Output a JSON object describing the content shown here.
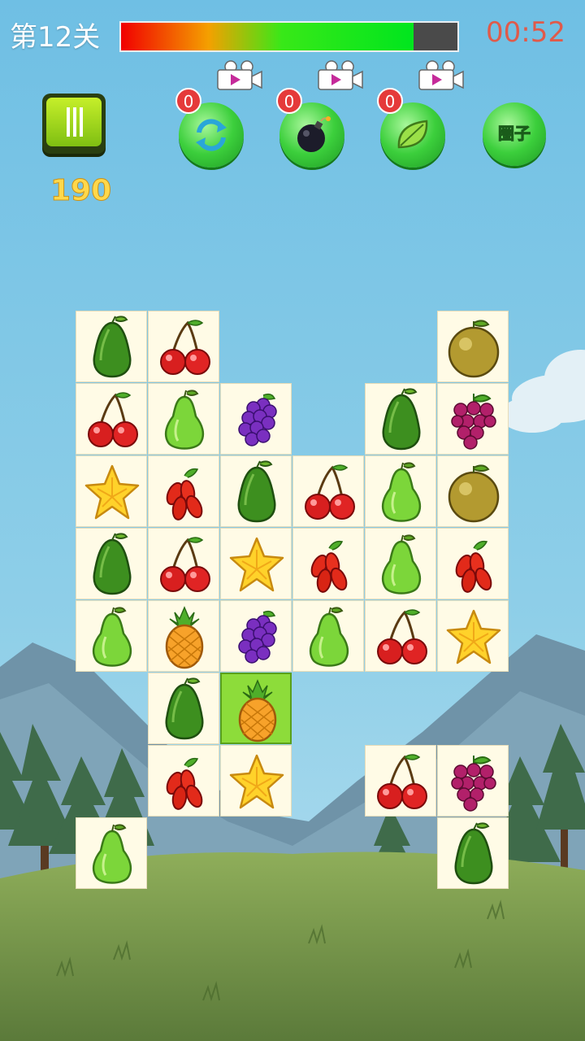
{
  "hud": {
    "level_label": "第12关",
    "timer_text": "00:52",
    "time_remaining_fraction": 0.87,
    "score": "190"
  },
  "tools": [
    {
      "name": "shuffle",
      "count": "0",
      "icon": "refresh-icon"
    },
    {
      "name": "bomb",
      "count": "0",
      "icon": "bomb-icon"
    },
    {
      "name": "hint",
      "count": "0",
      "icon": "leaf-icon"
    }
  ],
  "circle_button_label": "圈子",
  "colors": {
    "timer_text": "#e05a4a",
    "score": "#ffd84a",
    "tool_green": "#3ccf3c",
    "tile_bg": "#fffbe6",
    "selected_tile": "#8ddc3a"
  },
  "board": {
    "cols": 6,
    "rows": 8,
    "selected": {
      "row": 5,
      "col": 2
    },
    "grid": [
      [
        "avocado",
        "cherry",
        null,
        null,
        null,
        "pear-gold"
      ],
      [
        "cherry",
        "pear",
        "grape",
        null,
        "avocado",
        "grape-red"
      ],
      [
        "star",
        "goji",
        "avocado",
        "cherry",
        "pear",
        "pear-gold"
      ],
      [
        "avocado",
        "cherry",
        "star",
        "goji",
        "pear",
        "goji"
      ],
      [
        "pear",
        "pineapple",
        "grape",
        "pear",
        "cherry",
        "star"
      ],
      [
        null,
        "avocado",
        "pineapple",
        null,
        null,
        null
      ],
      [
        null,
        "goji",
        "star",
        null,
        "cherry",
        "grape-red"
      ],
      [
        "pear",
        null,
        null,
        null,
        null,
        "avocado"
      ]
    ]
  }
}
